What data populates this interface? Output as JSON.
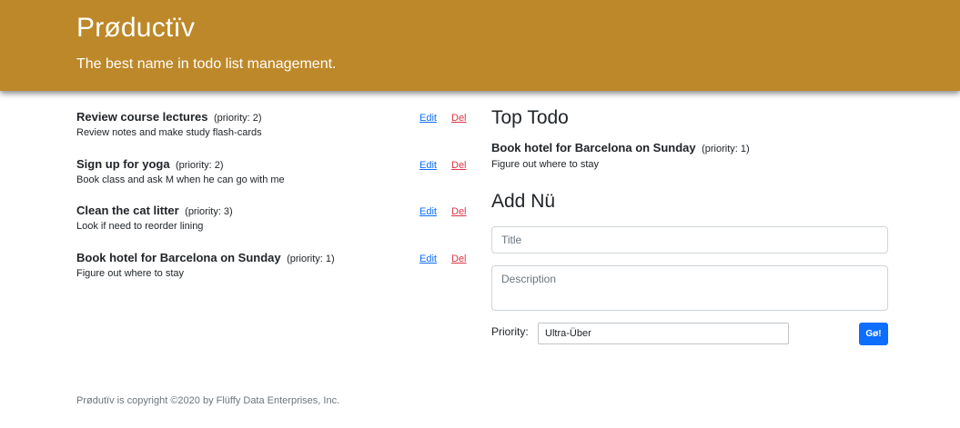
{
  "header": {
    "brand": "Prøductïv",
    "tagline": "The best name in todo list management."
  },
  "todos": [
    {
      "title": "Review course lectures",
      "priority": "(priority: 2)",
      "description": "Review notes and make study flash-cards",
      "edit_label": "Edit",
      "delete_label": "Del"
    },
    {
      "title": "Sign up for yoga",
      "priority": "(priority: 2)",
      "description": "Book class and ask M when he can go with me",
      "edit_label": "Edit",
      "delete_label": "Del"
    },
    {
      "title": "Clean the cat litter",
      "priority": "(priority: 3)",
      "description": "Look if need to reorder lining",
      "edit_label": "Edit",
      "delete_label": "Del"
    },
    {
      "title": "Book hotel for Barcelona on Sunday",
      "priority": "(priority: 1)",
      "description": "Figure out where to stay",
      "edit_label": "Edit",
      "delete_label": "Del"
    }
  ],
  "top_todo": {
    "heading": "Top Todo",
    "title": "Book hotel for Barcelona on Sunday",
    "priority": "(priority: 1)",
    "description": "Figure out where to stay"
  },
  "add_form": {
    "heading": "Add Nü",
    "title_placeholder": "Title",
    "description_placeholder": "Description",
    "priority_label": "Priority:",
    "priority_selected": "Ultra-Über",
    "submit_label": "Gø!"
  },
  "footer": {
    "text": "Prødutïv is copyright ©2020 by Flüffy Data Enterprises, Inc."
  },
  "colors": {
    "header_bg": "#bd8829",
    "link_edit": "#0d6efd",
    "link_delete": "#dc3545",
    "button_primary": "#0d6efd"
  }
}
